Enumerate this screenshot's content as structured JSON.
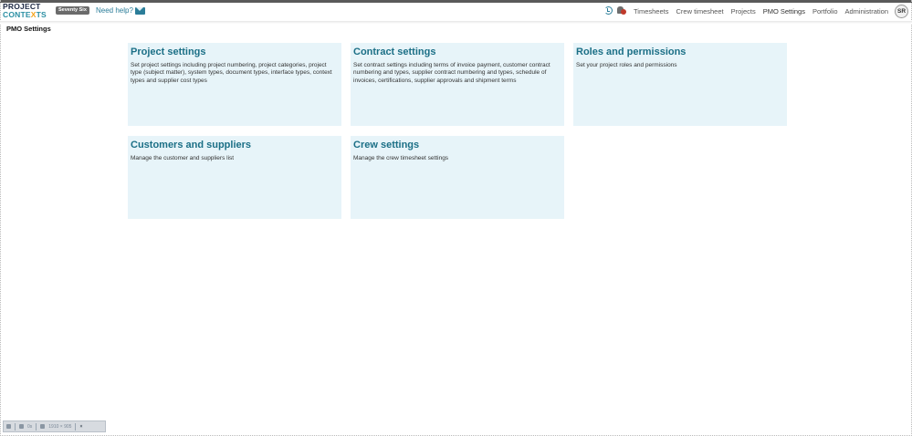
{
  "app": {
    "logo_line1": "PROJECT",
    "logo_line2_pre": "CONTE",
    "logo_line2_accent": "X",
    "logo_line2_post": "TS",
    "site_badge": "Seventy Six",
    "help_link": "Need help?",
    "user_initials": "SR",
    "icons": {
      "mail": "mail-icon",
      "history": "history-icon",
      "notifications": "bell-icon"
    },
    "colors": {
      "accent": "#2b7d99",
      "card_background": "#e7f4f9",
      "card_title": "#1b6f86",
      "logo_orange": "#f4a21b"
    }
  },
  "nav": {
    "items": [
      {
        "label": "Timesheets"
      },
      {
        "label": "Crew timesheet"
      },
      {
        "label": "Projects"
      },
      {
        "label": "PMO Settings",
        "active": true
      },
      {
        "label": "Portfolio"
      },
      {
        "label": "Administration"
      }
    ]
  },
  "page": {
    "title": "PMO Settings"
  },
  "cards": [
    {
      "title": "Project settings",
      "description": "Set project settings including project numbering, project categories, project type (subject matter), system types, document types, interface types, context types and supplier cost types"
    },
    {
      "title": "Contract settings",
      "description": "Set contract settings including terms of invoice payment, customer contract numbering and types, supplier contract numbering and types, schedule of invoices, certifications, supplier approvals and shipment terms"
    },
    {
      "title": "Roles and permissions",
      "description": "Set your project roles and permissions"
    },
    {
      "title": "Customers and suppliers",
      "description": "Manage the customer and suppliers list"
    },
    {
      "title": "Crew settings",
      "description": "Manage the crew timesheet settings"
    }
  ],
  "debug_toolbar": {
    "counter": "0s",
    "resolution": "1910 × 905",
    "close": "×"
  }
}
